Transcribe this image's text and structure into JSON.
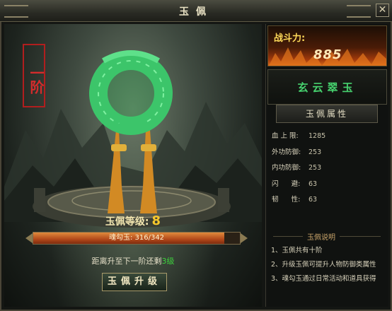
{
  "window": {
    "title": "玉佩",
    "close_glyph": "✕"
  },
  "scene": {
    "tier_badge": "一阶",
    "level_label": "玉佩等级:",
    "level_value": "8",
    "progress": {
      "label": "魂勾玉: 316/342",
      "current": 316,
      "max": 342
    },
    "remain_prefix": "距离升至下一阶还剩",
    "remain_value": "3级",
    "upgrade_button": "玉佩升级"
  },
  "side": {
    "power_label": "战斗力:",
    "power_value": "885",
    "jade_name": "玄云翠玉",
    "attr_header": "玉佩属性",
    "attributes": [
      {
        "key": "血 上 限:",
        "value": "1285"
      },
      {
        "key": "外功防御:",
        "value": "253"
      },
      {
        "key": "内功防御:",
        "value": "253"
      },
      {
        "key": "闪      避:",
        "value": "63"
      },
      {
        "key": "韧      性:",
        "value": "63"
      }
    ],
    "desc_title": "玉佩说明",
    "descriptions": [
      "1、玉佩共有十阶",
      "2、升级玉佩可提升人物防御类属性",
      "3、魂勾玉通过日常活动和道具获得"
    ]
  },
  "colors": {
    "title_text": "#e9e2c4",
    "jade_green": "#46d16e",
    "power_gold": "#ffdb5a",
    "progress_fill": "#c2541f",
    "badge_red": "#c42424",
    "next_level_green": "#3dd13d"
  }
}
